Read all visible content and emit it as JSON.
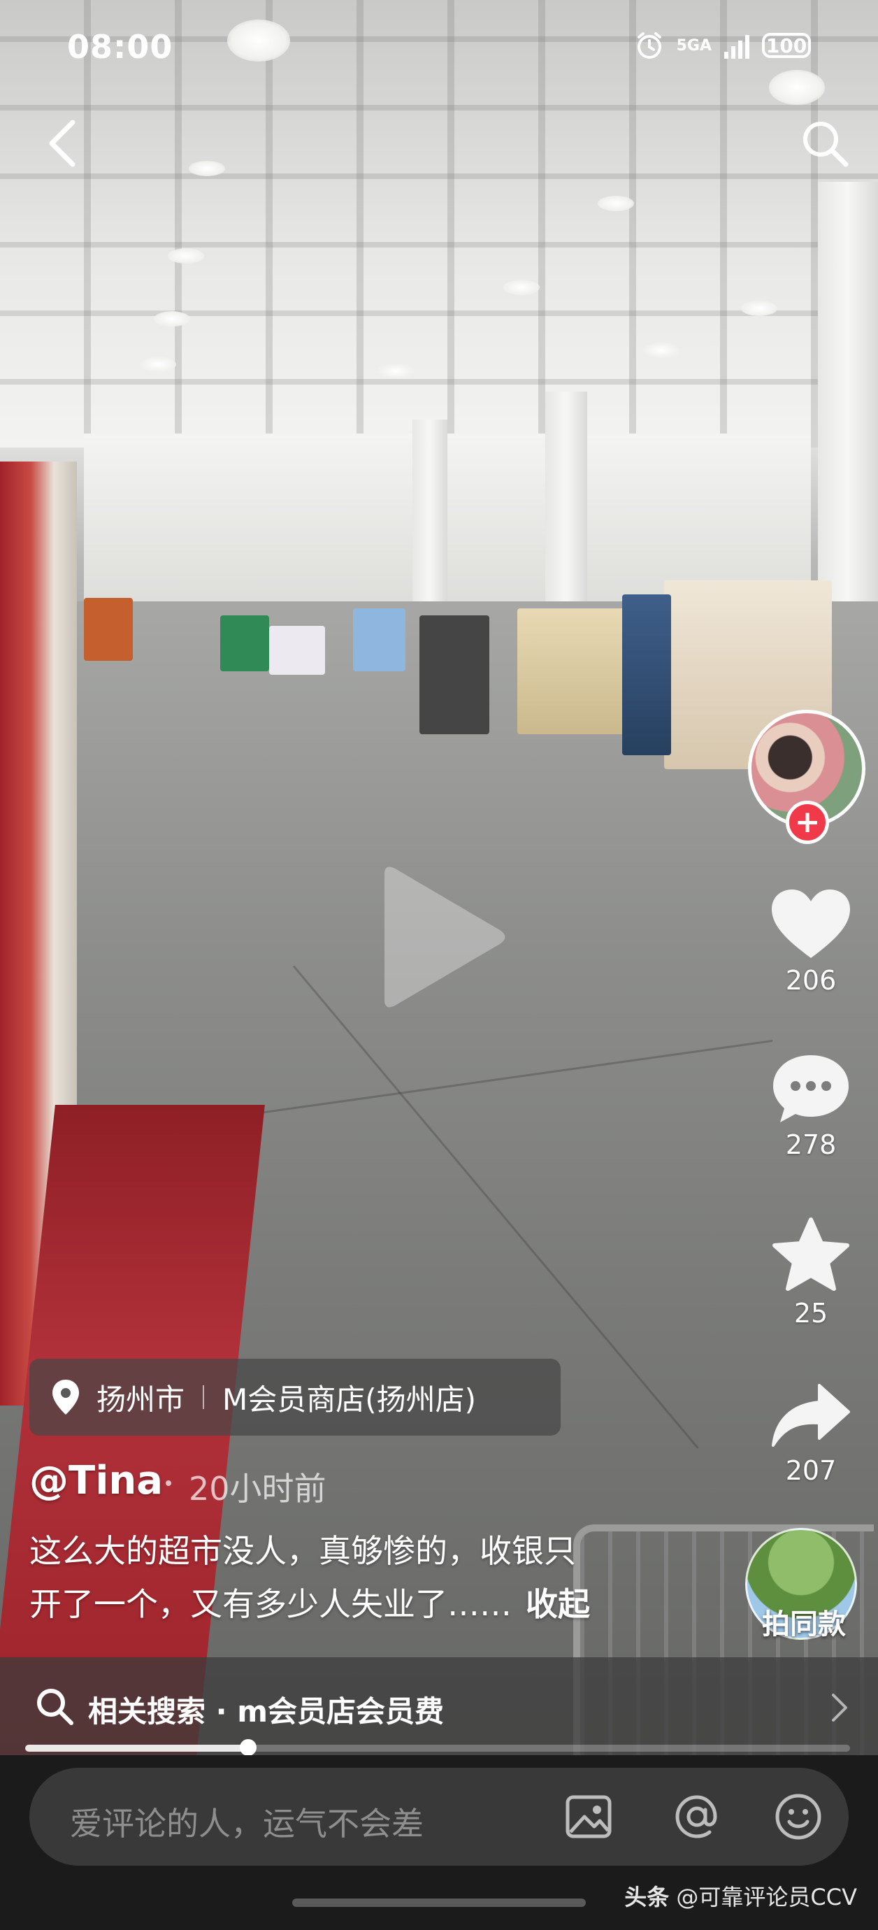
{
  "status_bar": {
    "time": "08:00",
    "network": "5GA",
    "battery": "100"
  },
  "right_rail": {
    "like_count": "206",
    "comment_count": "278",
    "favorite_count": "25",
    "share_count": "207",
    "same_style_label": "拍同款",
    "follow_symbol": "+"
  },
  "location": {
    "city": "扬州市",
    "place": "M会员商店(扬州店)"
  },
  "post": {
    "author": "@Tina",
    "time_ago": "20小时前",
    "caption_line1": "这么大的超市没人，真够惨的，收银只",
    "caption_line2": "开了一个，又有多少人失业了……",
    "collapse_label": "收起"
  },
  "related_search": {
    "label": "相关搜索 · m会员店会员费"
  },
  "playback": {
    "progress_fraction": 0.27
  },
  "comment_bar": {
    "placeholder": "爱评论的人，运气不会差"
  },
  "watermark": {
    "brand": "头条",
    "handle": "@可靠评论员CCV"
  },
  "icons": {
    "back": "back-arrow-icon",
    "search": "search-icon",
    "play": "play-icon",
    "like": "heart-icon",
    "comment": "comment-bubble-icon",
    "favorite": "star-icon",
    "share": "share-arrow-icon",
    "location": "location-pin-icon",
    "image": "image-icon",
    "mention": "at-icon",
    "emoji": "emoji-icon"
  }
}
